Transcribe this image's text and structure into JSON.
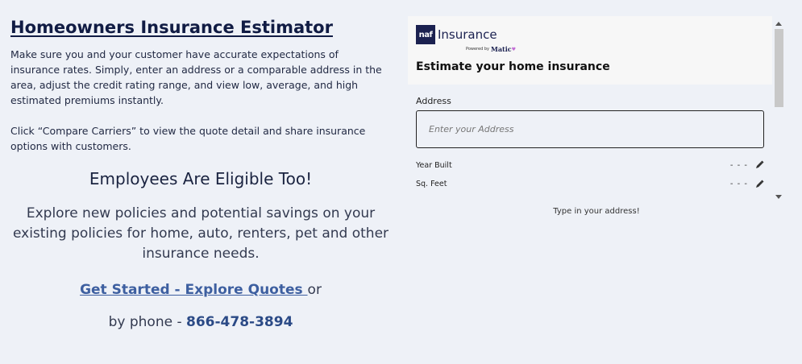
{
  "left": {
    "title": "Homeowners Insurance Estimator",
    "intro_p1": "Make sure you and your customer have accurate expectations of insurance rates. Simply, enter an address or a comparable address in the area, adjust the credit rating range, and view low, average, and high estimated premiums instantly.",
    "intro_p2": "Click “Compare Carriers” to view the quote detail and share insurance options with customers.",
    "employees_title": "Employees Are Eligible Too!",
    "employees_text": "Explore new policies and potential savings on your existing policies for home, auto, renters, pet and other insurance needs.",
    "cta_link": "Get Started - Explore Quotes ",
    "cta_or": " or",
    "phone_prefix": "by phone - ",
    "phone": "866-478-3894"
  },
  "widget": {
    "logo_box": "naf",
    "logo_word": "Insurance",
    "powered_by": "Powered by",
    "powered_brand": "Matic",
    "heading": "Estimate your home insurance",
    "address_label": "Address",
    "address_placeholder": "Enter your Address",
    "fields": [
      {
        "label": "Year Built",
        "value": "- - -"
      },
      {
        "label": "Sq. Feet",
        "value": "- - -"
      }
    ],
    "hint": "Type in your address!"
  },
  "colors": {
    "background": "#eef1f7",
    "title": "#111c44",
    "link": "#3d5fa0",
    "phone": "#2b4a86",
    "logo": "#1b2150"
  },
  "icons": [
    "pencil-icon",
    "scroll-up-arrow-icon",
    "scroll-down-arrow-icon",
    "heart-icon"
  ]
}
